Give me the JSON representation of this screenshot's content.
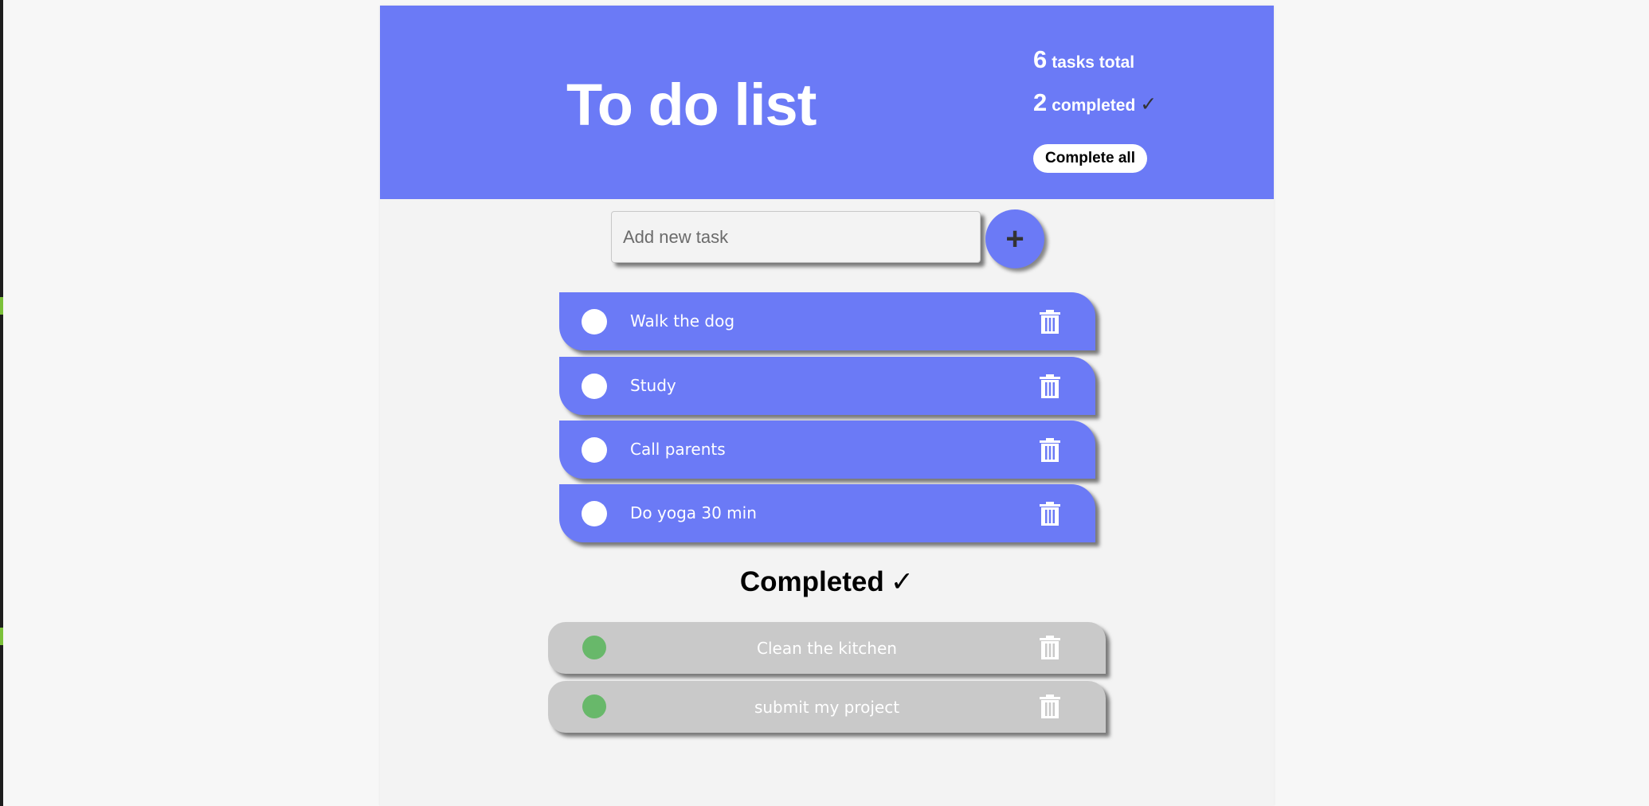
{
  "header": {
    "title": "To do list",
    "total_count": "6",
    "total_label": "tasks total",
    "completed_count": "2",
    "completed_label": "completed",
    "check_glyph": "✓",
    "complete_all_label": "Complete all"
  },
  "add_task": {
    "placeholder": "Add new task",
    "value": "",
    "add_button_label": "+"
  },
  "tasks": [
    {
      "label": "Walk the dog",
      "completed": false
    },
    {
      "label": "Study",
      "completed": false
    },
    {
      "label": "Call parents",
      "completed": false
    },
    {
      "label": "Do yoga 30 min",
      "completed": false
    }
  ],
  "completed_section": {
    "heading": "Completed",
    "check_glyph": "✓",
    "tasks": [
      {
        "label": "Clean the kitchen",
        "completed": true
      },
      {
        "label": "submit my project",
        "completed": true
      }
    ]
  },
  "icons": {
    "delete": "trash-icon",
    "toggle_open": "circle-icon",
    "toggle_done": "filled-circle-icon"
  },
  "colors": {
    "accent": "#6b7af6",
    "page_background": "#f3f3f3",
    "completed_item": "#c9c9c9",
    "completed_toggle": "#68b86a",
    "text_on_accent": "#ffffff"
  }
}
